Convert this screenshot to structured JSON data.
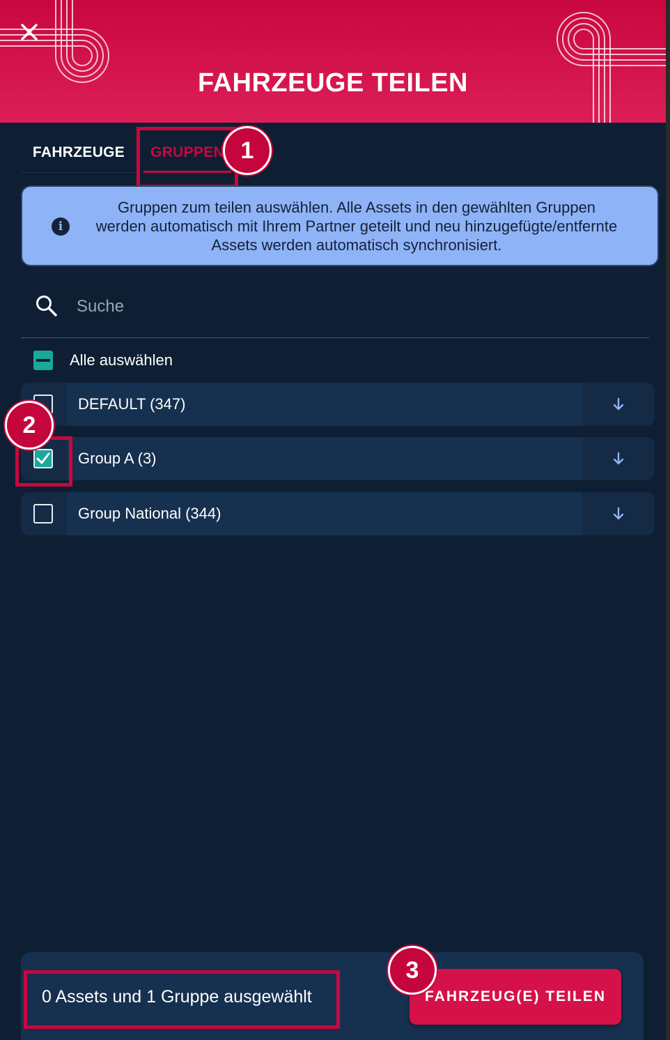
{
  "header": {
    "title": "FAHRZEUGE TEILEN",
    "close_icon": "close-icon",
    "background_color": "#d0104a"
  },
  "tabs": [
    {
      "label": "FAHRZEUGE",
      "active": false
    },
    {
      "label": "GRUPPEN",
      "active": true
    }
  ],
  "info_banner": {
    "icon": "info-icon",
    "text": "Gruppen zum teilen auswählen. Alle Assets in den gewählten Gruppen werden automatisch mit Ihrem Partner geteilt und neu hinzugefügte/entfernte Assets werden automatisch synchronisiert."
  },
  "search": {
    "placeholder": "Suche",
    "value": ""
  },
  "select_all": {
    "label": "Alle auswählen",
    "state": "indeterminate"
  },
  "groups": [
    {
      "label": "DEFAULT (347)",
      "checked": false
    },
    {
      "label": "Group A (3)",
      "checked": true
    },
    {
      "label": "Group National (344)",
      "checked": false
    }
  ],
  "footer": {
    "status": "0 Assets und 1 Gruppe ausgewählt",
    "share_button": "FAHRZEUG(E) TEILEN"
  },
  "callouts": [
    "1",
    "2",
    "3"
  ],
  "colors": {
    "accent": "#c9073f",
    "background": "#0e1f33",
    "row": "#16304f",
    "checkbox": "#1aa89a",
    "info": "#8fb3f7"
  }
}
